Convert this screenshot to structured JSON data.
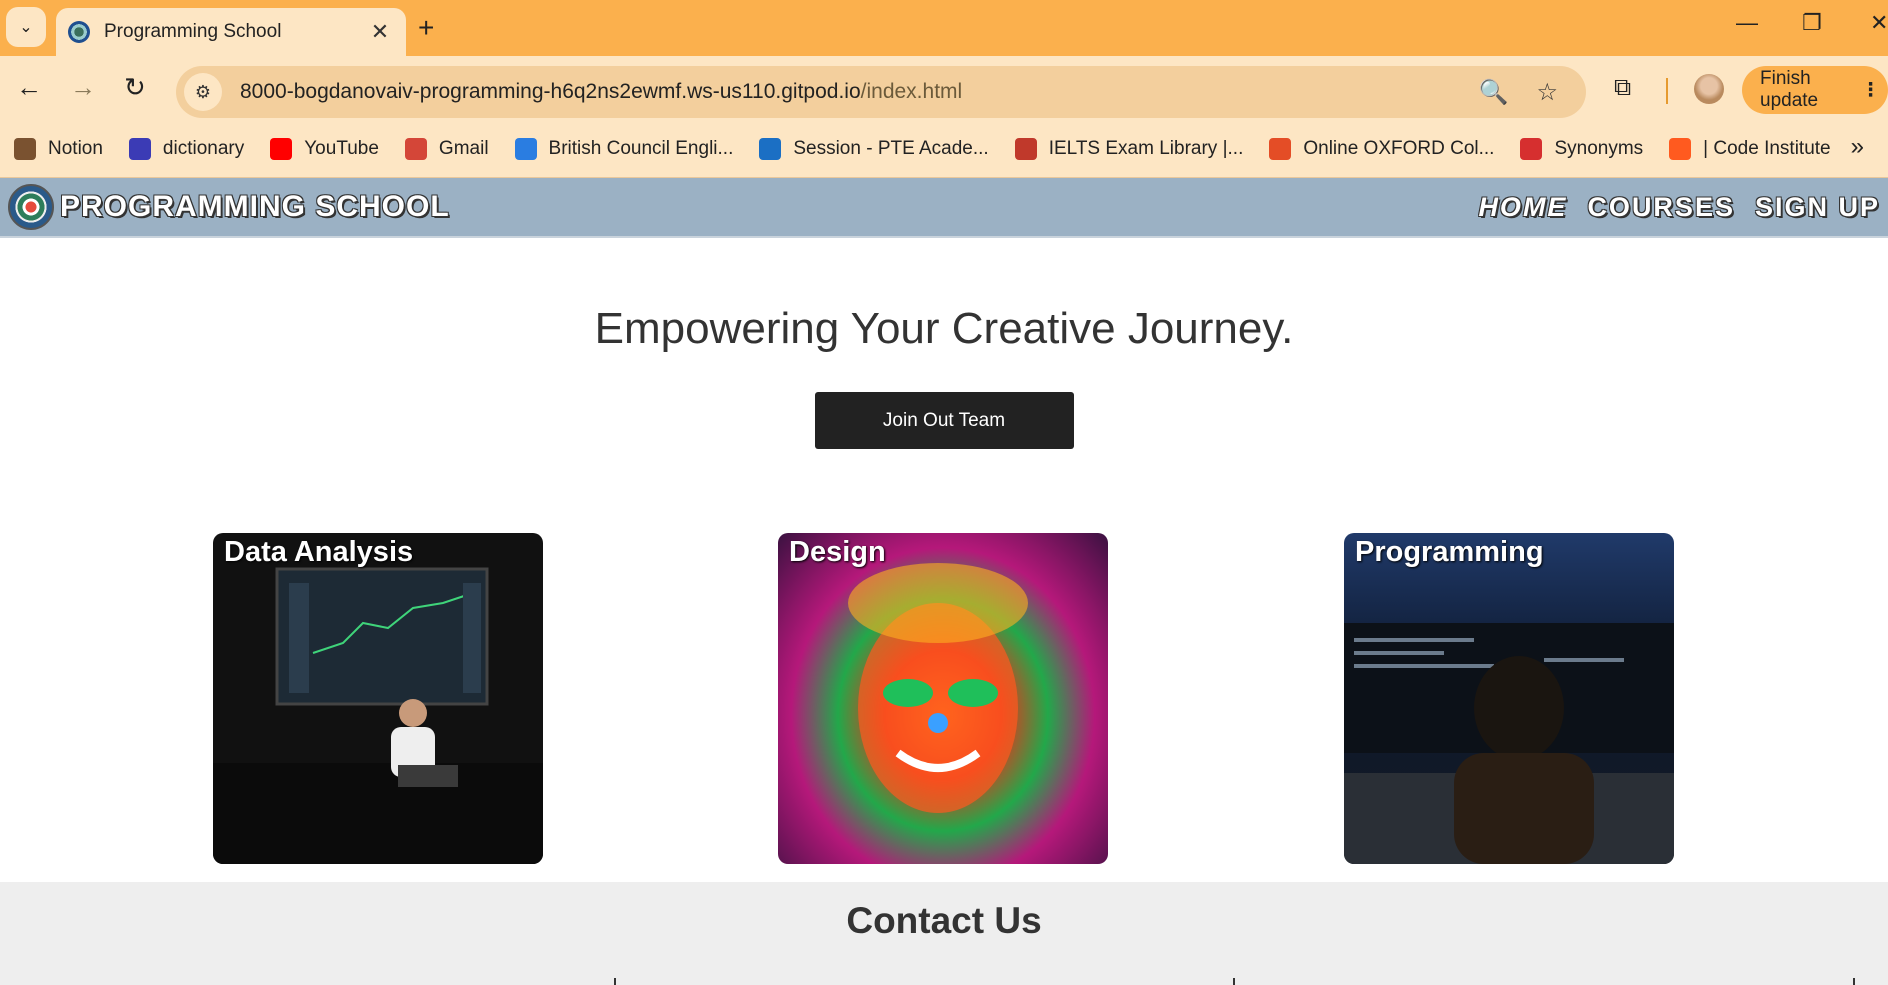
{
  "browser": {
    "tab_title": "Programming School",
    "tab_close": "✕",
    "new_tab": "+",
    "url_host": "8000-bogdanovaiv-programming-h6q2ns2ewmf.ws-us110.gitpod.io",
    "url_path": "/index.html",
    "finish_update": "Finish update",
    "bookmarks": [
      {
        "label": "Notion",
        "icon": "notion-icon",
        "color": "#7a5230"
      },
      {
        "label": "dictionary",
        "icon": "dictionary-icon",
        "color": "#3b3bb5"
      },
      {
        "label": "YouTube",
        "icon": "youtube-icon",
        "color": "#ff0000"
      },
      {
        "label": "Gmail",
        "icon": "gmail-icon",
        "color": "#d44638"
      },
      {
        "label": "British Council Engli...",
        "icon": "british-council-icon",
        "color": "#2a7de1"
      },
      {
        "label": "Session - PTE Acade...",
        "icon": "pte-icon",
        "color": "#1b6fc4"
      },
      {
        "label": "IELTS Exam Library |...",
        "icon": "ielts-icon",
        "color": "#c0392b"
      },
      {
        "label": "Online OXFORD Col...",
        "icon": "oxford-icon",
        "color": "#e44d26"
      },
      {
        "label": "Synonyms",
        "icon": "synonyms-icon",
        "color": "#d62f2f"
      },
      {
        "label": "| Code Institute",
        "icon": "code-institute-icon",
        "color": "#ff5a1f"
      }
    ]
  },
  "site": {
    "brand": "PROGRAMMING SCHOOL",
    "nav": [
      {
        "label": "HOME",
        "active": true
      },
      {
        "label": "COURSES",
        "active": false
      },
      {
        "label": "SIGN UP",
        "active": false
      }
    ],
    "hero_title": "Empowering Your Creative Journey.",
    "cta_label": "Join Out Team",
    "cards": [
      {
        "label": "Data Analysis"
      },
      {
        "label": "Design"
      },
      {
        "label": "Programming"
      }
    ],
    "contact_title": "Contact Us"
  }
}
